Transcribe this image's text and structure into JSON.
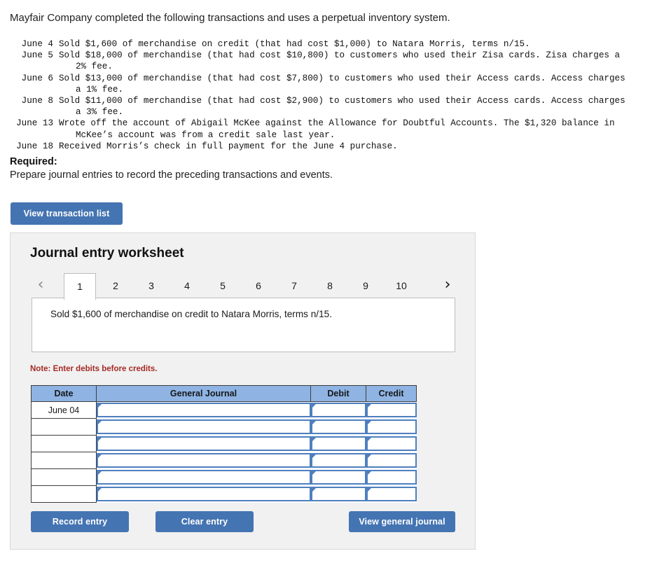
{
  "intro": "Mayfair Company completed the following transactions and uses a perpetual inventory system.",
  "transactions": [
    {
      "date": "June 4",
      "line1": "Sold $1,600 of merchandise on credit (that had cost $1,000) to Natara Morris, terms n/15.",
      "line2": ""
    },
    {
      "date": "June 5",
      "line1": "Sold $18,000 of merchandise (that had cost $10,800) to customers who used their Zisa cards. Zisa charges a",
      "line2": "2% fee."
    },
    {
      "date": "June 6",
      "line1": "Sold $13,000 of merchandise (that had cost $7,800) to customers who used their Access cards. Access charges",
      "line2": "a 1% fee."
    },
    {
      "date": "June 8",
      "line1": "Sold $11,000 of merchandise (that had cost $2,900) to customers who used their Access cards. Access charges",
      "line2": "a 3% fee."
    },
    {
      "date": "June 13",
      "line1": "Wrote off the account of Abigail McKee against the Allowance for Doubtful Accounts. The $1,320 balance in",
      "line2": "McKee’s account was from a credit sale last year."
    },
    {
      "date": "June 18",
      "line1": "Received Morris’s check in full payment for the June 4 purchase.",
      "line2": ""
    }
  ],
  "required": {
    "label": "Required:",
    "text": "Prepare journal entries to record the preceding transactions and events."
  },
  "buttons": {
    "view_transaction_list": "View transaction list",
    "record_entry": "Record entry",
    "clear_entry": "Clear entry",
    "view_general_journal": "View general journal"
  },
  "worksheet": {
    "title": "Journal entry worksheet",
    "prev_icon": "chevron-left-icon",
    "next_icon": "chevron-right-icon",
    "prev_glyph": "‹",
    "next_glyph": "›",
    "tabs": [
      "1",
      "2",
      "3",
      "4",
      "5",
      "6",
      "7",
      "8",
      "9",
      "10"
    ],
    "active_tab": "1",
    "description": "Sold $1,600 of merchandise on credit to Natara Morris, terms n/15.",
    "note": "Note: Enter debits before credits."
  },
  "journal_table": {
    "headers": [
      "Date",
      "General Journal",
      "Debit",
      "Credit"
    ],
    "rows": [
      {
        "date": "June 04",
        "general_journal": "",
        "debit": "",
        "credit": ""
      },
      {
        "date": "",
        "general_journal": "",
        "debit": "",
        "credit": ""
      },
      {
        "date": "",
        "general_journal": "",
        "debit": "",
        "credit": ""
      },
      {
        "date": "",
        "general_journal": "",
        "debit": "",
        "credit": ""
      },
      {
        "date": "",
        "general_journal": "",
        "debit": "",
        "credit": ""
      },
      {
        "date": "",
        "general_journal": "",
        "debit": "",
        "credit": ""
      }
    ]
  },
  "colors": {
    "button_blue": "#4474b2",
    "table_header_blue": "#8fb4e3",
    "cell_border_blue": "#4f7fbf",
    "note_red": "#a42b25",
    "panel_bg": "#f1f1f1"
  }
}
